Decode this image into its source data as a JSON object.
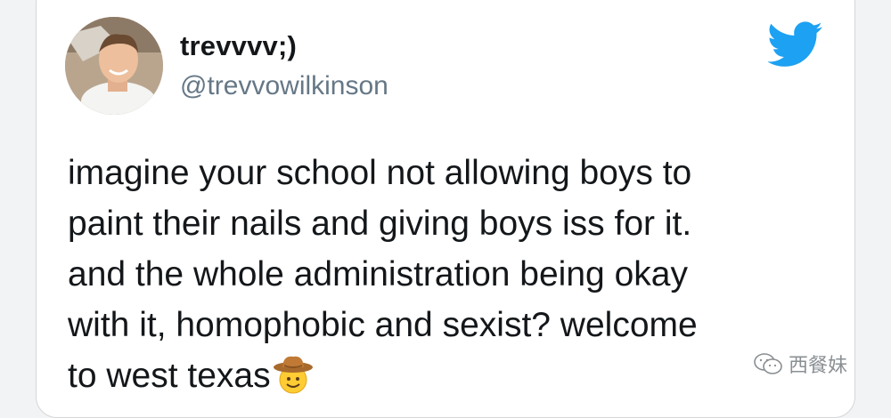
{
  "tweet": {
    "display_name": "trevvvv;)",
    "handle": "@trevvowilkinson",
    "text_lines": [
      "imagine your school not allowing boys to",
      "paint their nails and giving boys iss for it.",
      "and the whole administration being okay",
      "with it, homophobic and sexist? welcome",
      "to west texas"
    ],
    "emoji": "cowboy-hat-face",
    "brand_icon": "twitter-bird-icon"
  },
  "watermark": {
    "text": "西餐妹",
    "icon": "wechat-icon"
  },
  "colors": {
    "twitter_blue": "#1da1f2",
    "text": "#14171a",
    "handle_gray": "#657786",
    "card_border": "#d4d6d8"
  }
}
